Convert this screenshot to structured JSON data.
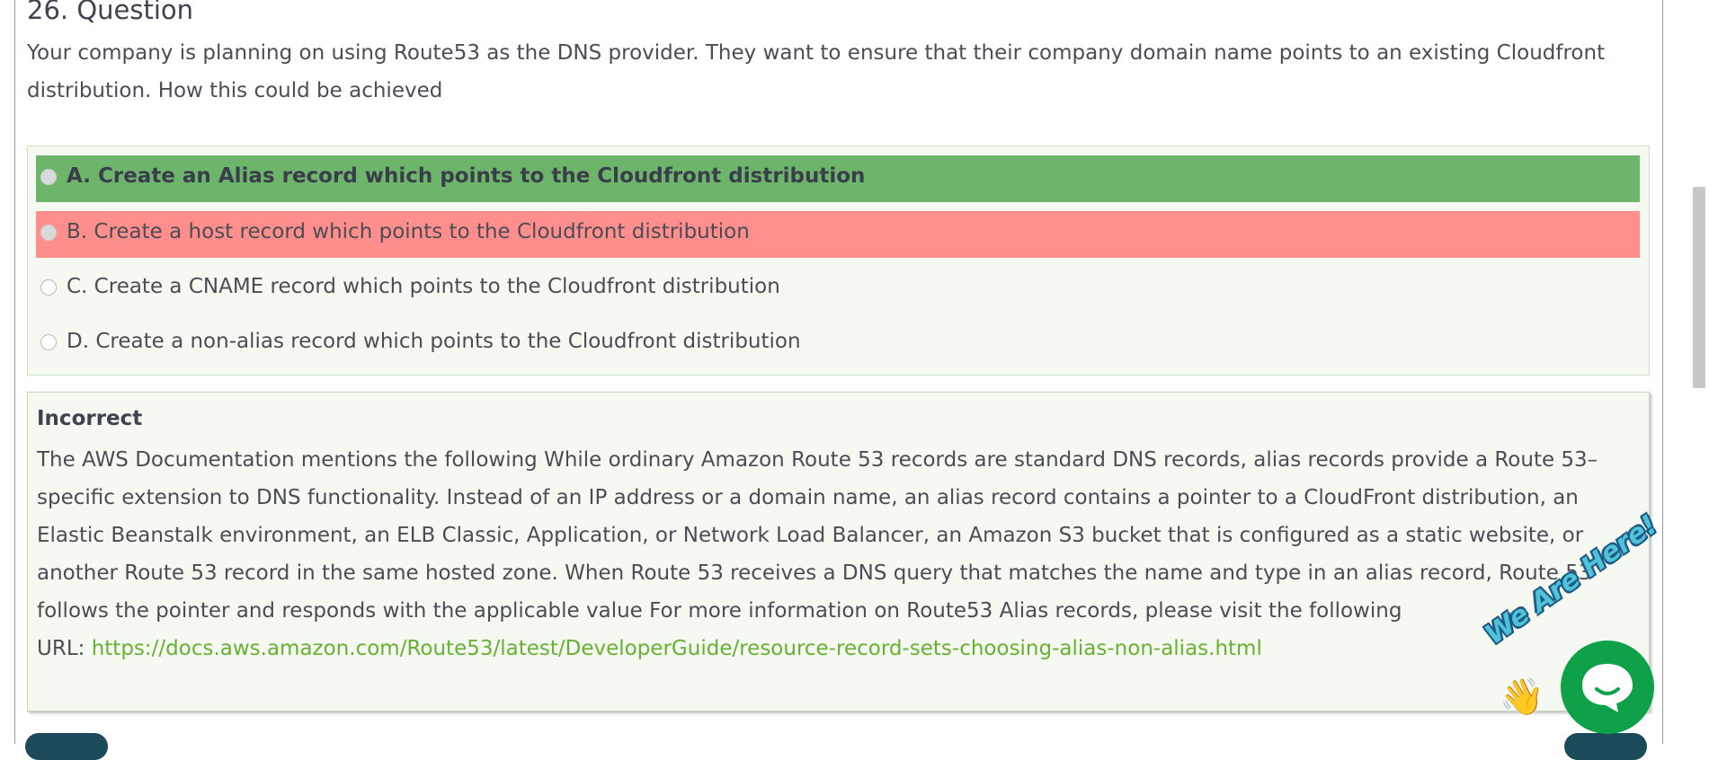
{
  "question": {
    "title": "26. Question",
    "text": "Your company is planning on using Route53 as the DNS provider. They want to ensure that their company domain name points to an existing Cloudfront distribution. How this could be achieved"
  },
  "options": [
    {
      "label": "A. Create an Alias record which points to the Cloudfront distribution",
      "state": "correct"
    },
    {
      "label": "B. Create a host record which points to the Cloudfront distribution",
      "state": "selected-wrong"
    },
    {
      "label": "C. Create a CNAME record which points to the Cloudfront distribution",
      "state": "neutral"
    },
    {
      "label": "D. Create a non-alias record which points to the Cloudfront distribution",
      "state": "neutral"
    }
  ],
  "explanation": {
    "status": "Incorrect",
    "body": "The AWS Documentation mentions the following While ordinary Amazon Route 53 records are standard DNS records, alias records provide a Route 53–specific extension to DNS functionality. Instead of an IP address or a domain name, an alias record contains a pointer to a CloudFront distribution, an Elastic Beanstalk environment, an ELB Classic, Application, or Network Load Balancer, an Amazon S3 bucket that is configured as a static website, or another Route 53 record in the same hosted zone. When Route 53 receives a DNS query that matches the name and type in an alias record, Route 53 follows the pointer and responds with the applicable value For more information on Route53 Alias records, please visit the following",
    "url_prefix": "URL: ",
    "url": "https://docs.aws.amazon.com/Route53/latest/DeveloperGuide/resource-record-sets-choosing-alias-non-alias.html"
  },
  "chat_widget": {
    "badge_text": "We Are Here!",
    "icon": "chat-bubble-icon",
    "wave_icon": "waving-hand-icon",
    "color": "#0fa14a"
  },
  "colors": {
    "correct": "#6db56b",
    "wrong": "#ff8e8c",
    "link": "#66b032"
  }
}
